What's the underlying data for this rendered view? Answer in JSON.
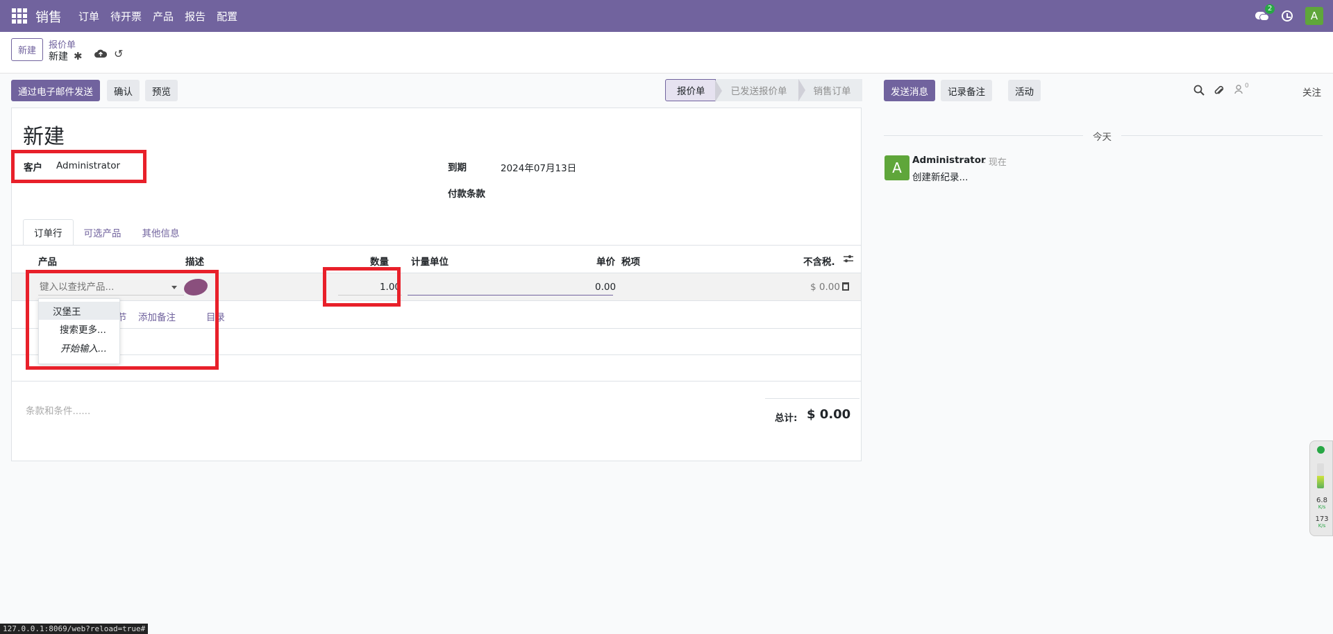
{
  "topnav": {
    "app_name": "销售",
    "menu": [
      "订单",
      "待开票",
      "产品",
      "报告",
      "配置"
    ],
    "chat_badge": "2",
    "user_initial": "A",
    "bg_color": "#71639e"
  },
  "controlpanel": {
    "new_label": "新建",
    "breadcrumb": "报价单",
    "record_name": "新建",
    "gear_icon": "gear-icon",
    "save_icon": "cloud-upload-icon",
    "discard_icon": "undo-icon"
  },
  "actions": {
    "send_email": "通过电子邮件发送",
    "confirm": "确认",
    "preview": "预览"
  },
  "statusbar": {
    "stages": [
      "报价单",
      "已发送报价单",
      "销售订单"
    ],
    "active": "报价单"
  },
  "form": {
    "title": "新建",
    "customer_label": "客户",
    "customer_value": "Administrator",
    "expiry_label": "到期",
    "expiry_value": "2024年07月13日",
    "payment_terms_label": "付款条款",
    "tabs": [
      "订单行",
      "可选产品",
      "其他信息"
    ],
    "columns": {
      "product": "产品",
      "description": "描述",
      "quantity": "数量",
      "uom": "计量单位",
      "price": "单价",
      "taxes": "税项",
      "subtotal": "不含税."
    },
    "line": {
      "product_placeholder": "键入以查找产品...",
      "quantity": "1.00",
      "price": "0.00",
      "subtotal": "$ 0.00"
    },
    "links": {
      "section_partial": "节",
      "add_note": "添加备注",
      "catalog": "目录"
    },
    "dropdown": [
      "汉堡王",
      "搜索更多...",
      "开始输入..."
    ],
    "terms_placeholder": "条款和条件......",
    "total_label": "总计:",
    "total_value": "$ 0.00"
  },
  "chatter": {
    "send_message": "发送消息",
    "log_note": "记录备注",
    "activity": "活动",
    "follower_count": "0",
    "follow": "关注",
    "today": "今天",
    "message": {
      "initial": "A",
      "author": "Administrator",
      "time": "- 现在",
      "body": "创建新纪录..."
    }
  },
  "widget": {
    "up_speed": "6.8",
    "up_unit": "K/s",
    "down_speed": "173",
    "down_unit": "K/s"
  },
  "status_url": "127.0.0.1:8069/web?reload=true#",
  "colors": {
    "accent": "#71639e",
    "annotation": "#e8202a",
    "avatar": "#5fa63a"
  }
}
